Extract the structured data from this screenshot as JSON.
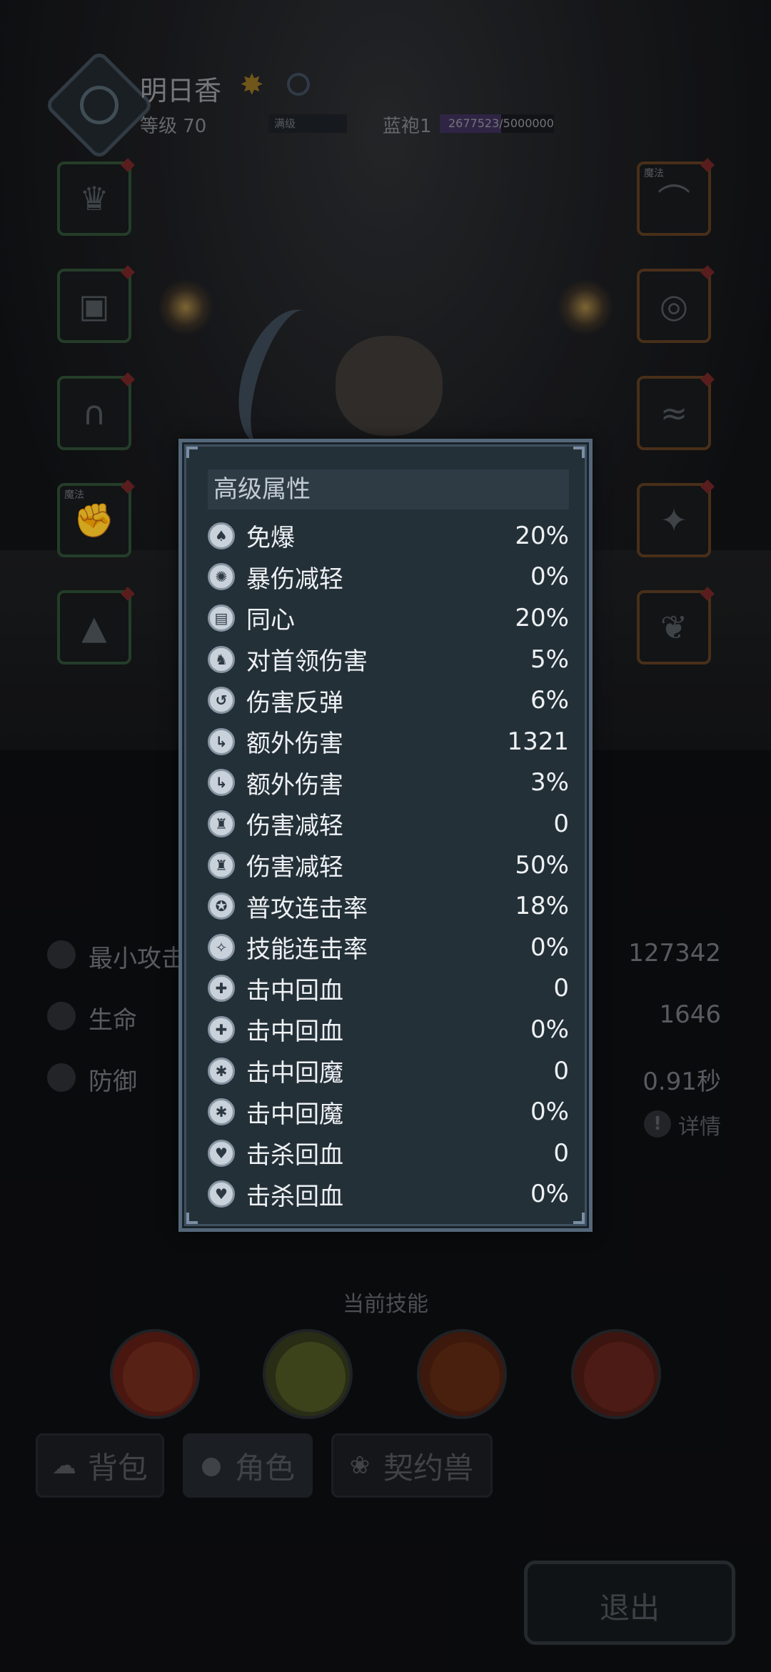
{
  "header": {
    "hero_name": "明日香",
    "level_text": "等级 70",
    "max_label": "满级",
    "rank_text": "蓝袍1",
    "exp_text": "2677523/5000000",
    "exp_progress": 0.5355
  },
  "equipment": {
    "left": [
      {
        "icon": "helmet-icon",
        "glyph": "♛",
        "rarity": "green",
        "tag": ""
      },
      {
        "icon": "armor-icon",
        "glyph": "▣",
        "rarity": "green",
        "tag": ""
      },
      {
        "icon": "pants-icon",
        "glyph": "∩",
        "rarity": "green",
        "tag": ""
      },
      {
        "icon": "gauntlet-icon",
        "glyph": "✊",
        "rarity": "green",
        "tag": "魔法"
      },
      {
        "icon": "cloak-icon",
        "glyph": "▲",
        "rarity": "green",
        "tag": ""
      }
    ],
    "right": [
      {
        "icon": "necklace-icon",
        "glyph": "⌒",
        "rarity": "orange",
        "tag": "魔法"
      },
      {
        "icon": "ring-icon",
        "glyph": "◎",
        "rarity": "orange",
        "tag": ""
      },
      {
        "icon": "belt-icon",
        "glyph": "≈",
        "rarity": "orange",
        "tag": ""
      },
      {
        "icon": "flame-charm-icon",
        "glyph": "✦",
        "rarity": "orange",
        "tag": ""
      },
      {
        "icon": "wing-icon",
        "glyph": "❦",
        "rarity": "orange",
        "tag": ""
      }
    ]
  },
  "base_stats": [
    {
      "label": "最小攻击",
      "value": "127342",
      "icon": "attack-icon"
    },
    {
      "label": "生命",
      "value": "1646",
      "icon": "heart-icon"
    },
    {
      "label": "防御",
      "value": "0.91秒",
      "icon": "shield-icon"
    }
  ],
  "detail_label": "详情",
  "skills_label": "当前技能",
  "skills": [
    {
      "icon": "crown-shield-skill-icon",
      "outer": "#5a1c14",
      "inner": "#6b2a1a"
    },
    {
      "icon": "bubbles-skill-icon",
      "outer": "#33381a",
      "inner": "#4a5222"
    },
    {
      "icon": "fire-swirl-skill-icon",
      "outer": "#4a1e10",
      "inner": "#5a2612"
    },
    {
      "icon": "crossed-axes-skill-icon",
      "outer": "#4a1a14",
      "inner": "#5e221a"
    }
  ],
  "tabs": [
    {
      "label": "背包",
      "icon": "bag-icon",
      "glyph": "☁"
    },
    {
      "label": "角色",
      "icon": "character-icon",
      "glyph": "●"
    },
    {
      "label": "契约兽",
      "icon": "paw-icon",
      "glyph": "❀"
    }
  ],
  "exit_label": "退出",
  "panel": {
    "title": "高级属性",
    "attributes": [
      {
        "name": "免爆",
        "value": "20%",
        "icon": "mushroom-icon",
        "glyph": "♠"
      },
      {
        "name": "暴伤减轻",
        "value": "0%",
        "icon": "swirl-icon",
        "glyph": "✺"
      },
      {
        "name": "同心",
        "value": "20%",
        "icon": "scroll-icon",
        "glyph": "▤"
      },
      {
        "name": "对首领伤害",
        "value": "5%",
        "icon": "beast-head-icon",
        "glyph": "♞"
      },
      {
        "name": "伤害反弹",
        "value": "6%",
        "icon": "rebound-icon",
        "glyph": "↺"
      },
      {
        "name": "额外伤害",
        "value": "1321",
        "icon": "boot-icon",
        "glyph": "↳"
      },
      {
        "name": "额外伤害",
        "value": "3%",
        "icon": "boot-icon",
        "glyph": "↳"
      },
      {
        "name": "伤害减轻",
        "value": "0",
        "icon": "vest-icon",
        "glyph": "♜"
      },
      {
        "name": "伤害减轻",
        "value": "50%",
        "icon": "vest-icon",
        "glyph": "♜"
      },
      {
        "name": "普攻连击率",
        "value": "18%",
        "icon": "combo-icon",
        "glyph": "✪"
      },
      {
        "name": "技能连击率",
        "value": "0%",
        "icon": "skill-combo-icon",
        "glyph": "✧"
      },
      {
        "name": "击中回血",
        "value": "0",
        "icon": "hit-heal-icon",
        "glyph": "✚"
      },
      {
        "name": "击中回血",
        "value": "0%",
        "icon": "hit-heal-icon",
        "glyph": "✚"
      },
      {
        "name": "击中回魔",
        "value": "0",
        "icon": "hit-mana-icon",
        "glyph": "✱"
      },
      {
        "name": "击中回魔",
        "value": "0%",
        "icon": "hit-mana-icon",
        "glyph": "✱"
      },
      {
        "name": "击杀回血",
        "value": "0",
        "icon": "kill-heal-icon",
        "glyph": "♥"
      },
      {
        "name": "击杀回血",
        "value": "0%",
        "icon": "kill-heal-icon",
        "glyph": "♥"
      }
    ]
  }
}
